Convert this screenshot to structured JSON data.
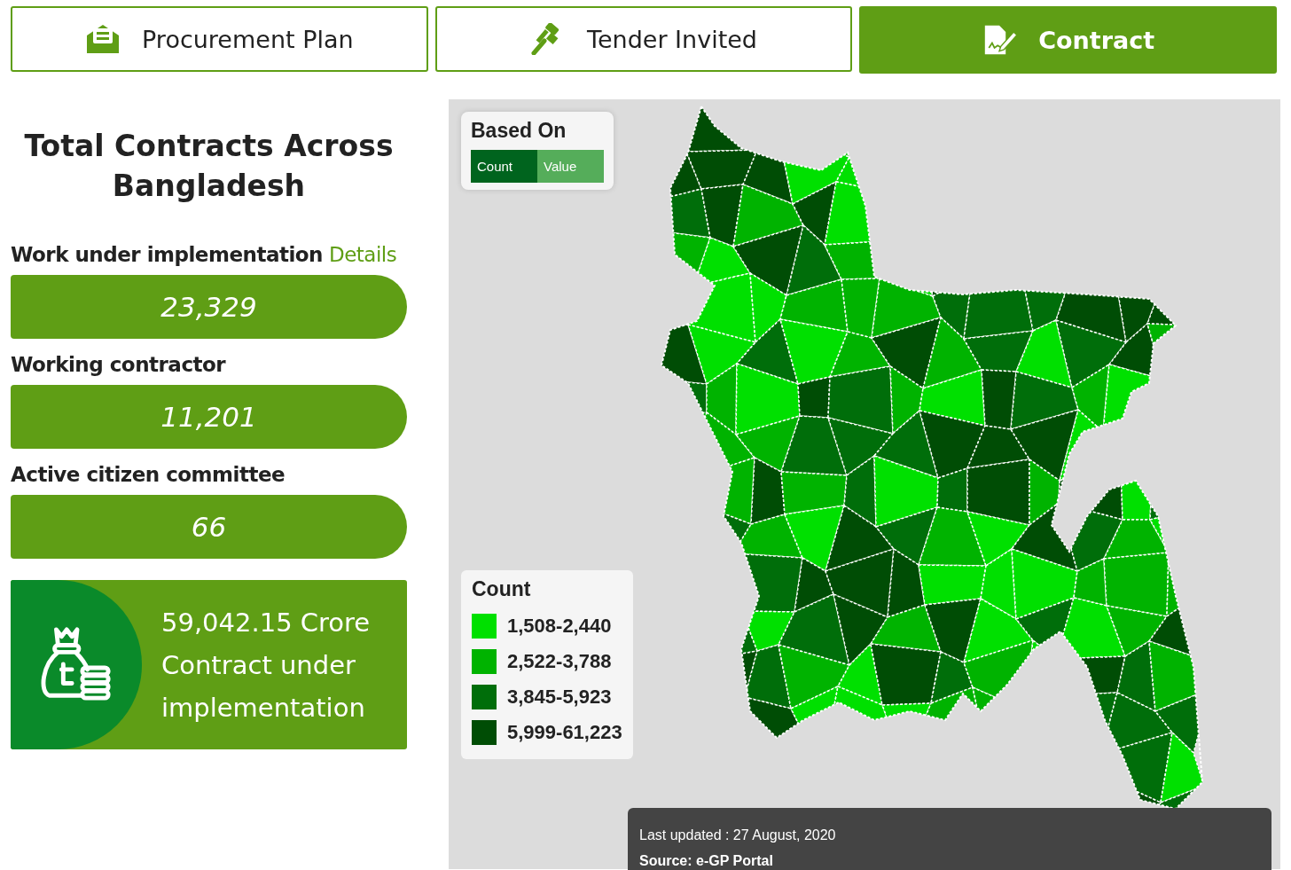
{
  "tabs": [
    {
      "label": "Procurement Plan",
      "kind": "plan",
      "selected": false
    },
    {
      "label": "Tender Invited",
      "kind": "tender",
      "selected": false
    },
    {
      "label": "Contract",
      "kind": "contract",
      "selected": true
    }
  ],
  "summary": {
    "title": "Total Contracts Across Bangladesh",
    "stats": [
      {
        "label": "Work under implementation",
        "link": "Details",
        "value": "23,329"
      },
      {
        "label": "Working contractor",
        "value": "11,201"
      },
      {
        "label": "Active citizen committee",
        "value": "66"
      }
    ],
    "amount_card": {
      "amount": "59,042.15 Crore",
      "caption": "Contract under implementation"
    }
  },
  "map": {
    "based_on": {
      "title": "Based On",
      "options": [
        {
          "label": "Count",
          "selected": true
        },
        {
          "label": "Value",
          "selected": false
        }
      ]
    },
    "legend": {
      "title": "Count",
      "items": [
        {
          "label": "1,508-2,440",
          "color": "#00e000"
        },
        {
          "label": "2,522-3,788",
          "color": "#00b300"
        },
        {
          "label": "3,845-5,923",
          "color": "#006e0a"
        },
        {
          "label": "5,999-61,223",
          "color": "#004d05"
        }
      ]
    },
    "footer": {
      "updated": "Last updated : 27 August, 2020",
      "source": "Source: e-GP Portal"
    }
  }
}
